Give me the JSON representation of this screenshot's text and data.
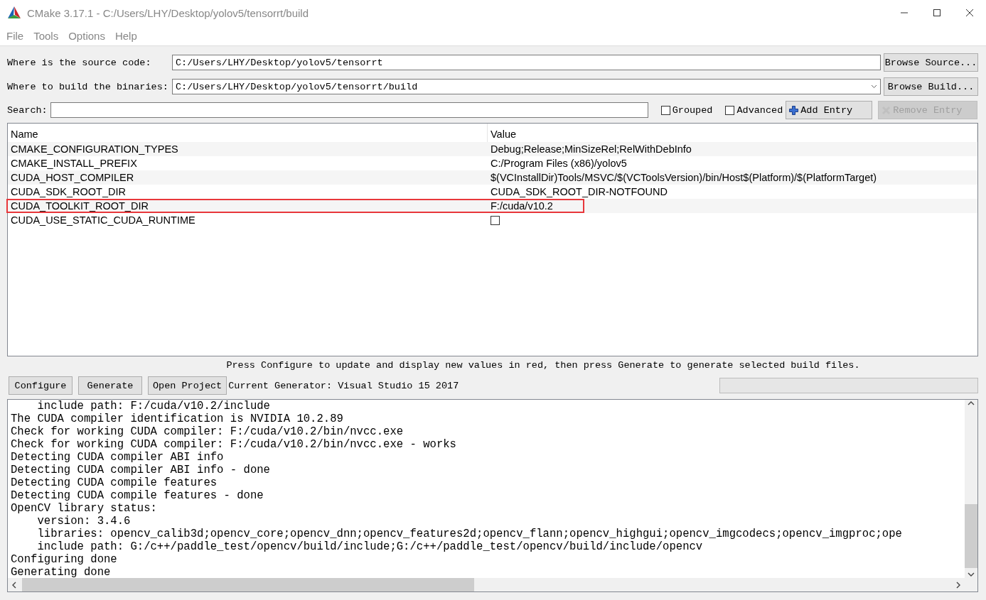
{
  "window": {
    "title": "CMake 3.17.1 - C:/Users/LHY/Desktop/yolov5/tensorrt/build"
  },
  "menu": [
    "File",
    "Tools",
    "Options",
    "Help"
  ],
  "source": {
    "label": "Where is the source code:",
    "value": "C:/Users/LHY/Desktop/yolov5/tensorrt",
    "button": "Browse Source..."
  },
  "build": {
    "label": "Where to build the binaries:",
    "value": "C:/Users/LHY/Desktop/yolov5/tensorrt/build",
    "button": "Browse Build..."
  },
  "search": {
    "label": "Search:"
  },
  "options": [
    {
      "label": "Grouped",
      "checked": false
    },
    {
      "label": "Advanced",
      "checked": false
    }
  ],
  "entry_buttons": [
    {
      "kind": "add",
      "label": "Add Entry",
      "disabled": false
    },
    {
      "kind": "remove",
      "label": "Remove Entry",
      "disabled": true
    }
  ],
  "table": {
    "columns": [
      "Name",
      "Value"
    ],
    "rows": [
      {
        "name": "CMAKE_CONFIGURATION_TYPES",
        "kind": "text",
        "value": "Debug;Release;MinSizeRel;RelWithDebInfo",
        "highlighted": false
      },
      {
        "name": "CMAKE_INSTALL_PREFIX",
        "kind": "text",
        "value": "C:/Program Files (x86)/yolov5",
        "highlighted": false
      },
      {
        "name": "CUDA_HOST_COMPILER",
        "kind": "text",
        "value": "$(VCInstallDir)Tools/MSVC/$(VCToolsVersion)/bin/Host$(Platform)/$(PlatformTarget)",
        "highlighted": false
      },
      {
        "name": "CUDA_SDK_ROOT_DIR",
        "kind": "text",
        "value": "CUDA_SDK_ROOT_DIR-NOTFOUND",
        "highlighted": false
      },
      {
        "name": "CUDA_TOOLKIT_ROOT_DIR",
        "kind": "text",
        "value": "F:/cuda/v10.2",
        "highlighted": true
      },
      {
        "name": "CUDA_USE_STATIC_CUDA_RUNTIME",
        "kind": "checkbox",
        "checked": false,
        "highlighted": false
      }
    ]
  },
  "hint": "Press Configure to update and display new values in red, then press Generate to generate selected build files.",
  "buttons": [
    "Configure",
    "Generate",
    "Open Project"
  ],
  "generator": "Current Generator: Visual Studio 15 2017",
  "progress": {
    "level": 0
  },
  "log": [
    "    include path: F:/cuda/v10.2/include",
    "The CUDA compiler identification is NVIDIA 10.2.89",
    "Check for working CUDA compiler: F:/cuda/v10.2/bin/nvcc.exe",
    "Check for working CUDA compiler: F:/cuda/v10.2/bin/nvcc.exe - works",
    "Detecting CUDA compiler ABI info",
    "Detecting CUDA compiler ABI info - done",
    "Detecting CUDA compile features",
    "Detecting CUDA compile features - done",
    "OpenCV library status:",
    "    version: 3.4.6",
    "    libraries: opencv_calib3d;opencv_core;opencv_dnn;opencv_features2d;opencv_flann;opencv_highgui;opencv_imgcodecs;opencv_imgproc;ope",
    "    include path: G:/c++/paddle_test/opencv/build/include;G:/c++/paddle_test/opencv/build/include/opencv",
    "Configuring done",
    "Generating done"
  ]
}
